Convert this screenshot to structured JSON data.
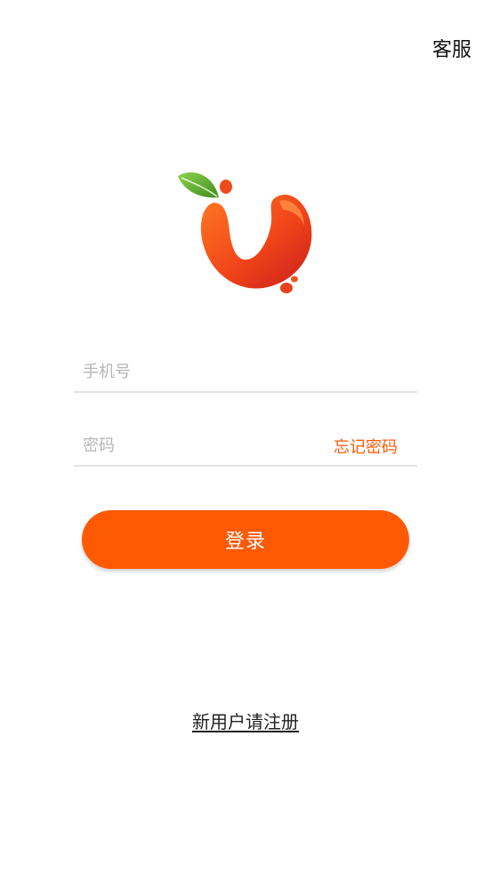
{
  "header": {
    "customer_service_label": "客服"
  },
  "logo": {
    "icon": "apple-v-logo",
    "colors": {
      "leaf": "#5cab2a",
      "body_light": "#ff6a1a",
      "body_dark": "#d8261c"
    }
  },
  "login_form": {
    "phone_placeholder": "手机号",
    "phone_value": "",
    "password_placeholder": "密码",
    "password_value": "",
    "forgot_password_label": "忘记密码",
    "login_button_label": "登录"
  },
  "footer": {
    "register_label": "新用户请注册"
  },
  "colors": {
    "accent": "#ff5a03",
    "divider": "#e3e3e3",
    "placeholder": "#b5b5b5"
  }
}
